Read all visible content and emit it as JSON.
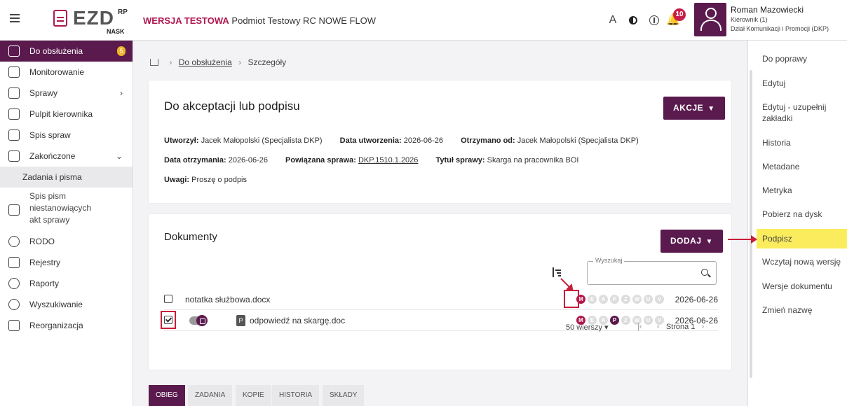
{
  "header": {
    "logo_text": "EZD",
    "logo_sup": "RP",
    "logo_sub": "NASK",
    "env_label": "WERSJA TESTOWA",
    "env_entity": "Podmiot Testowy RC NOWE FLOW",
    "font_icon_label": "A",
    "notifications_count": "10",
    "user_name": "Roman Mazowiecki",
    "user_role": "Kierownik (1)",
    "user_dept": "Dział Komunikacji i Promocji (DKP)"
  },
  "sidebar": {
    "items": [
      {
        "label": "Do obsłużenia",
        "count": "5"
      },
      {
        "label": "Monitorowanie"
      },
      {
        "label": "Sprawy",
        "chevron": "›"
      },
      {
        "label": "Pulpit kierownika"
      },
      {
        "label": "Spis spraw"
      },
      {
        "label": "Zakończone",
        "chevron": "⌄"
      },
      {
        "label": "Zadania i pisma"
      },
      {
        "label": "Spis pism niestanowiących akt sprawy"
      },
      {
        "label": "RODO"
      },
      {
        "label": "Rejestry"
      },
      {
        "label": "Raporty"
      },
      {
        "label": "Wyszukiwanie"
      },
      {
        "label": "Reorganizacja"
      }
    ]
  },
  "breadcrumb": {
    "sep": "›",
    "item1": "Do obsłużenia",
    "item2": "Szczegóły"
  },
  "details": {
    "title": "Do akceptacji lub podpisu",
    "actions_label": "AKCJE",
    "created_by_label": "Utworzył:",
    "created_by": "Jacek Małopolski (Specjalista DKP)",
    "created_date_label": "Data utworzenia:",
    "created_date": "2026-06-26",
    "received_from_label": "Otrzymano od:",
    "received_from": "Jacek Małopolski (Specjalista DKP)",
    "received_date_label": "Data otrzymania:",
    "received_date": "2026-06-26",
    "related_case_label": "Powiązana sprawa:",
    "related_case": "DKP.1510.1.2026",
    "case_title_label": "Tytuł sprawy:",
    "case_title": "Skarga na pracownika BOI",
    "notes_label": "Uwagi:",
    "notes": "Proszę o podpis"
  },
  "documents": {
    "title": "Dokumenty",
    "add_label": "DODAJ",
    "search_label": "Wyszukaj",
    "search_value": "",
    "rows": [
      {
        "name": "notatka służbowa.docx",
        "date": "2026-06-26",
        "checked": false
      },
      {
        "name": "odpowiedź na skargę.doc",
        "date": "2026-06-26",
        "checked": true,
        "type_badge": "P"
      }
    ],
    "status_letters": [
      "M",
      "E",
      "A",
      "P",
      "Z",
      "W",
      "U",
      "V"
    ],
    "rows_per_page": "50 wierszy",
    "page_label": "Strona 1"
  },
  "tabs": [
    "OBIEG",
    "ZADANIA",
    "KOPIE",
    "HISTORIA",
    "SKŁADY"
  ],
  "right_actions": [
    "Do poprawy",
    "Edytuj",
    "Edytuj - uzupełnij zakładki",
    "Historia",
    "Metadane",
    "Metryka",
    "Pobierz na dysk",
    "Podpisz",
    "Wczytaj nową wersję",
    "Wersje dokumentu",
    "Zmień nazwę"
  ],
  "colors": {
    "brand": "#5a1a4e",
    "accent": "#b0164e",
    "highlight": "#fbec5d",
    "annotation": "#c81e3a"
  }
}
